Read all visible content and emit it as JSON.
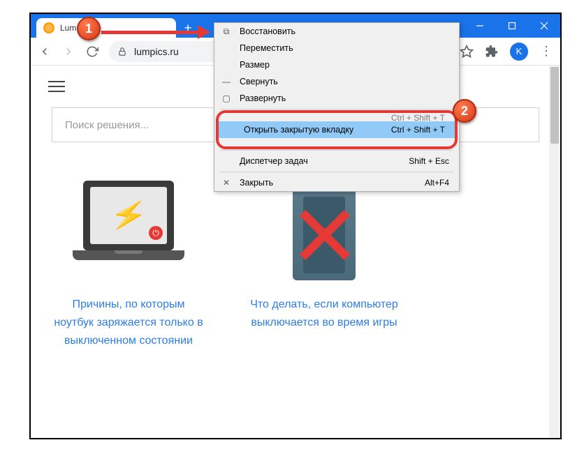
{
  "window": {
    "tab_title": "Lum",
    "url": "lumpics.ru",
    "avatar_letter": "K"
  },
  "page": {
    "search_placeholder": "Поиск решения...",
    "card1_title": "Причины, по которым ноутбук заряжается только в выключенном состоянии",
    "card2_title": "Что делать, если компьютер выключается во время игры"
  },
  "context_menu": {
    "restore": "Восстановить",
    "move": "Переместить",
    "size": "Размер",
    "minimize": "Свернуть",
    "maximize": "Развернуть",
    "reopen_tab": "Открыть закрытую вкладку",
    "reopen_tab_shortcut": "Ctrl + Shift + T",
    "task_manager": "Диспетчер задач",
    "task_manager_shortcut": "Shift + Esc",
    "close": "Закрыть",
    "close_shortcut": "Alt+F4",
    "obscured_shortcut_top": "Ctrl + Shift + T"
  },
  "markers": {
    "m1": "1",
    "m2": "2"
  }
}
